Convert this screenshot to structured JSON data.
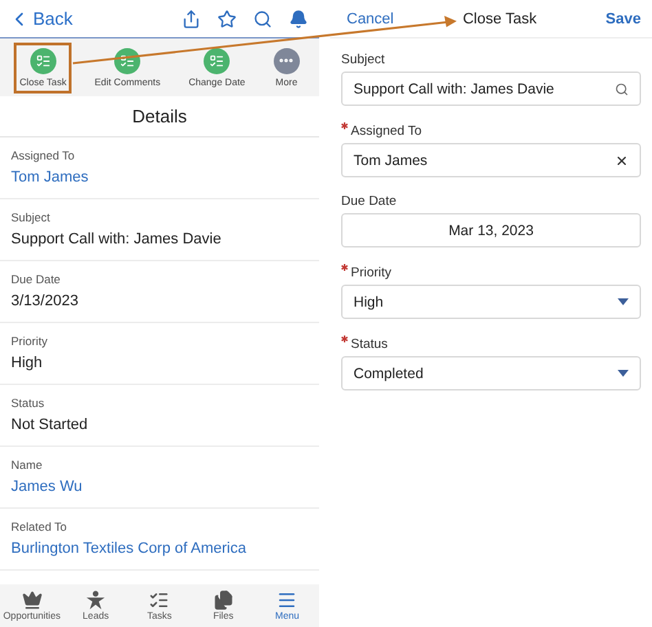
{
  "record_header": {
    "back": "Back"
  },
  "actions": [
    {
      "label": "Close Task",
      "kind": "task",
      "color": "#4cb46e",
      "selected": true
    },
    {
      "label": "Edit Comments",
      "kind": "task",
      "color": "#4cb46e",
      "selected": false
    },
    {
      "label": "Change Date",
      "kind": "task",
      "color": "#4cb46e",
      "selected": false
    },
    {
      "label": "More",
      "kind": "more",
      "color": "#7f8799",
      "selected": false
    }
  ],
  "details": {
    "title": "Details",
    "fields": [
      {
        "label": "Assigned To",
        "value": "Tom James",
        "kind": "link"
      },
      {
        "label": "Subject",
        "value": "Support Call with: James Davie",
        "kind": "text"
      },
      {
        "label": "Due Date",
        "value": "3/13/2023",
        "kind": "text"
      },
      {
        "label": "Priority",
        "value": "High",
        "kind": "text"
      },
      {
        "label": "Status",
        "value": "Not Started",
        "kind": "text"
      },
      {
        "label": "Name",
        "value": "James Wu",
        "kind": "link"
      },
      {
        "label": "Related To",
        "value": "Burlington Textiles Corp of America",
        "kind": "link"
      }
    ]
  },
  "tab_bar": [
    {
      "label": "Opportunities",
      "kind": "crown",
      "selected": false
    },
    {
      "label": "Leads",
      "kind": "person",
      "selected": false
    },
    {
      "label": "Tasks",
      "kind": "tasks",
      "selected": false
    },
    {
      "label": "Files",
      "kind": "files",
      "selected": false
    },
    {
      "label": "Menu",
      "kind": "menu",
      "selected": true
    }
  ],
  "close_task_form": {
    "cancel": "Cancel",
    "title": "Close Task",
    "save": "Save",
    "fields": [
      {
        "label": "Subject",
        "value": "Support Call with: James Davie",
        "kind": "lookup",
        "required": false
      },
      {
        "label": "Assigned To",
        "value": "Tom James",
        "kind": "clearable",
        "required": true
      },
      {
        "label": "Due Date",
        "value": "Mar 13, 2023",
        "kind": "date",
        "required": false
      },
      {
        "label": "Priority",
        "value": "High",
        "kind": "picklist",
        "required": true
      },
      {
        "label": "Status",
        "value": "Completed",
        "kind": "picklist",
        "required": true
      }
    ]
  }
}
